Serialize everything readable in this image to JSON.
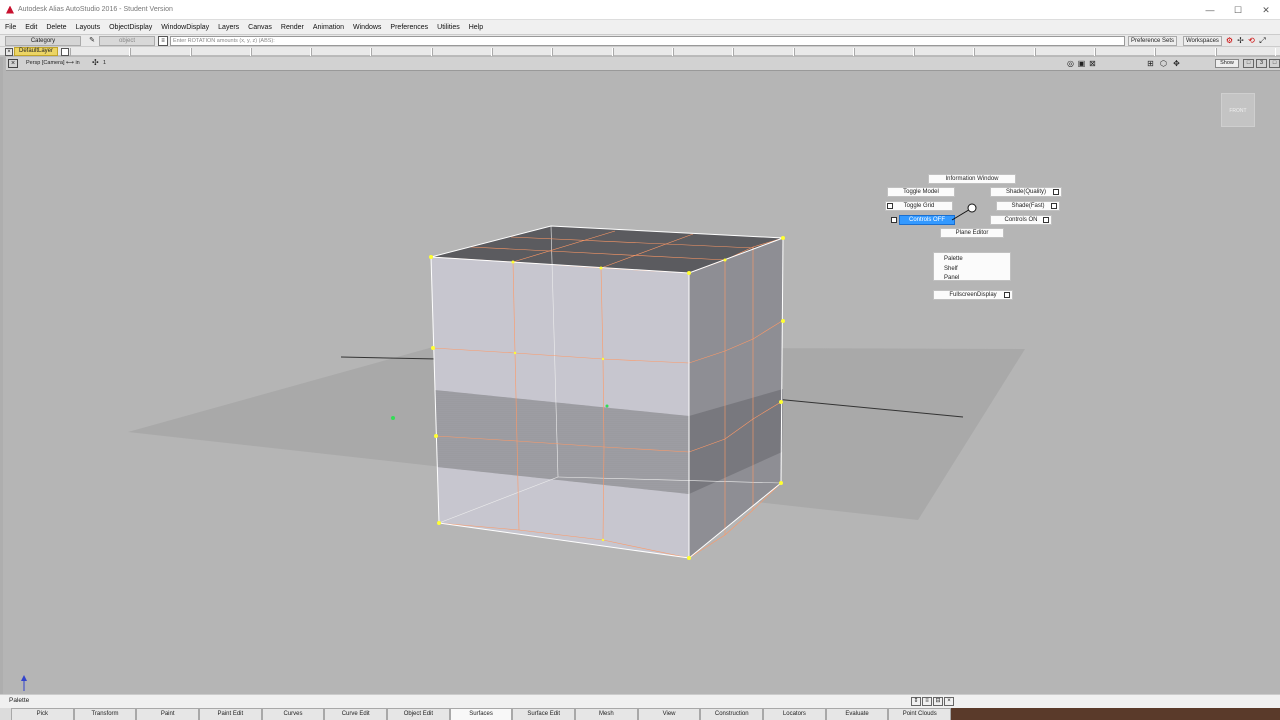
{
  "window": {
    "title": "Autodesk Alias AutoStudio 2016 - Student Version",
    "controls": [
      "—",
      "☐",
      "✕"
    ]
  },
  "menu": [
    "File",
    "Edit",
    "Delete",
    "Layouts",
    "ObjectDisplay",
    "WindowDisplay",
    "Layers",
    "Canvas",
    "Render",
    "Animation",
    "Windows",
    "Preferences",
    "Utilities",
    "Help"
  ],
  "prompt": {
    "category_label": "Category",
    "object_label": "object",
    "command_text": "Enter ROTATION amounts (x, y, z) (ABS):",
    "preference_sets": "Preference Sets",
    "workspaces": "Workspaces"
  },
  "layers": {
    "default_layer": "DefaultLayer"
  },
  "viewport": {
    "camera_label": "Persp [Camera] ⟷ in",
    "count": "1",
    "show_label": "Show",
    "viewcube_label": "FRONT"
  },
  "marking_menu": {
    "information_window": "Information Window",
    "toggle_model": "Toggle Model",
    "toggle_grid": "Toggle Grid",
    "controls_off": "Controls OFF",
    "shade_quality": "Shade(Quality)",
    "shade_fast": "Shade(Fast)",
    "controls_on": "Controls ON",
    "plane_editor": "Plane Editor",
    "list": [
      "Palette",
      "Shelf",
      "Panel"
    ],
    "fullscreen_display": "FullscreenDisplay"
  },
  "palette": {
    "label": "Palette",
    "tabs": [
      "Pick",
      "Transform",
      "Paint",
      "Paint Edit",
      "Curves",
      "Curve Edit",
      "Object Edit",
      "Surfaces",
      "Surface Edit",
      "Mesh",
      "View",
      "Construction",
      "Locators",
      "Evaluate",
      "Point Clouds"
    ],
    "active_tab": "Surfaces"
  },
  "colors": {
    "viewport_bg": "#b5b5b5",
    "layer_chip": "#ecd564",
    "selection": "#3399ff",
    "cv_points": "#ffff33",
    "hulls": "#ff9966"
  }
}
